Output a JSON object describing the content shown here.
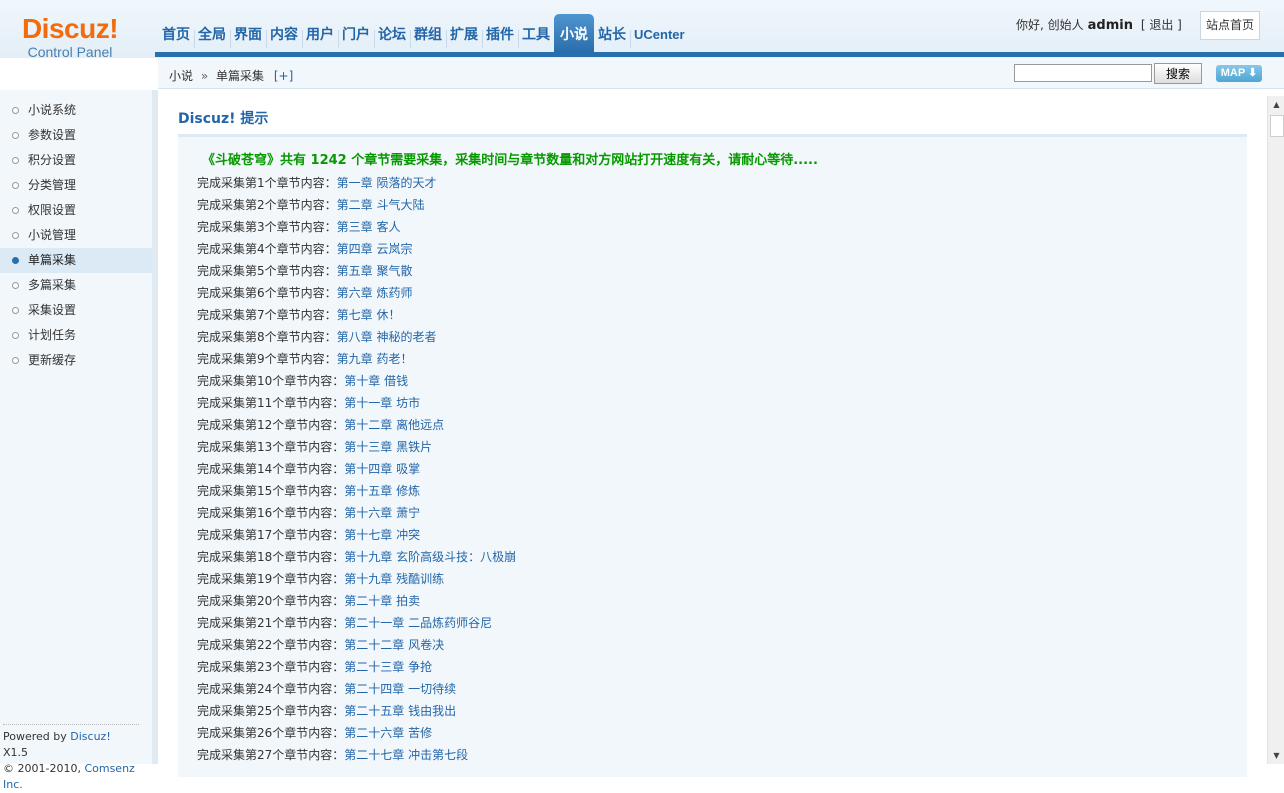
{
  "logo": {
    "brand": "Discuz!",
    "subtitle": "Control Panel"
  },
  "nav": {
    "items": [
      {
        "label": "首页",
        "active": false
      },
      {
        "label": "全局",
        "active": false
      },
      {
        "label": "界面",
        "active": false
      },
      {
        "label": "内容",
        "active": false
      },
      {
        "label": "用户",
        "active": false
      },
      {
        "label": "门户",
        "active": false
      },
      {
        "label": "论坛",
        "active": false
      },
      {
        "label": "群组",
        "active": false
      },
      {
        "label": "扩展",
        "active": false
      },
      {
        "label": "插件",
        "active": false
      },
      {
        "label": "工具",
        "active": false
      },
      {
        "label": "小说",
        "active": true
      },
      {
        "label": "站长",
        "active": false
      },
      {
        "label": "UCenter",
        "active": false
      }
    ]
  },
  "user": {
    "greeting": "你好, 创始人",
    "username": "admin",
    "logout_open": "[",
    "logout_label": "退出",
    "logout_close": "]",
    "site_home_label": "站点首页"
  },
  "breadcrumb": {
    "section": "小说",
    "separator": "»",
    "page": "单篇采集",
    "add_label": "[+]"
  },
  "search": {
    "value": "",
    "button_label": "搜索",
    "map_label": "MAP"
  },
  "sidebar": {
    "items": [
      {
        "label": "小说系统",
        "active": false
      },
      {
        "label": "参数设置",
        "active": false
      },
      {
        "label": "积分设置",
        "active": false
      },
      {
        "label": "分类管理",
        "active": false
      },
      {
        "label": "权限设置",
        "active": false
      },
      {
        "label": "小说管理",
        "active": false
      },
      {
        "label": "单篇采集",
        "active": true
      },
      {
        "label": "多篇采集",
        "active": false
      },
      {
        "label": "采集设置",
        "active": false
      },
      {
        "label": "计划任务",
        "active": false
      },
      {
        "label": "更新缓存",
        "active": false
      }
    ]
  },
  "footer": {
    "powered_prefix": "Powered by",
    "powered_link": "Discuz!",
    "version": "X1.5",
    "copyright_prefix": "© 2001-2010,",
    "company": "Comsenz Inc."
  },
  "main": {
    "title": "Discuz! 提示",
    "notice": "《斗破苍穹》共有 1242 个章节需要采集，采集时间与章节数量和对方网站打开速度有关，请耐心等待.....",
    "chapters": [
      {
        "prefix": "完成采集第1个章节内容：",
        "title": "第一章 陨落的天才"
      },
      {
        "prefix": "完成采集第2个章节内容：",
        "title": "第二章 斗气大陆"
      },
      {
        "prefix": "完成采集第3个章节内容：",
        "title": "第三章 客人"
      },
      {
        "prefix": "完成采集第4个章节内容：",
        "title": "第四章 云岚宗"
      },
      {
        "prefix": "完成采集第5个章节内容：",
        "title": "第五章 聚气散"
      },
      {
        "prefix": "完成采集第6个章节内容：",
        "title": "第六章 炼药师"
      },
      {
        "prefix": "完成采集第7个章节内容：",
        "title": "第七章 休！"
      },
      {
        "prefix": "完成采集第8个章节内容：",
        "title": "第八章 神秘的老者"
      },
      {
        "prefix": "完成采集第9个章节内容：",
        "title": "第九章 药老！"
      },
      {
        "prefix": "完成采集第10个章节内容：",
        "title": "第十章 借钱"
      },
      {
        "prefix": "完成采集第11个章节内容：",
        "title": "第十一章 坊市"
      },
      {
        "prefix": "完成采集第12个章节内容：",
        "title": "第十二章 离他远点"
      },
      {
        "prefix": "完成采集第13个章节内容：",
        "title": "第十三章 黑铁片"
      },
      {
        "prefix": "完成采集第14个章节内容：",
        "title": "第十四章 吸掌"
      },
      {
        "prefix": "完成采集第15个章节内容：",
        "title": "第十五章 修炼"
      },
      {
        "prefix": "完成采集第16个章节内容：",
        "title": "第十六章 萧宁"
      },
      {
        "prefix": "完成采集第17个章节内容：",
        "title": "第十七章 冲突"
      },
      {
        "prefix": "完成采集第18个章节内容：",
        "title": "第十九章 玄阶高级斗技：八极崩"
      },
      {
        "prefix": "完成采集第19个章节内容：",
        "title": "第十九章 残酷训练"
      },
      {
        "prefix": "完成采集第20个章节内容：",
        "title": "第二十章 拍卖"
      },
      {
        "prefix": "完成采集第21个章节内容：",
        "title": "第二十一章 二品炼药师谷尼"
      },
      {
        "prefix": "完成采集第22个章节内容：",
        "title": "第二十二章 风卷决"
      },
      {
        "prefix": "完成采集第23个章节内容：",
        "title": "第二十三章 争抢"
      },
      {
        "prefix": "完成采集第24个章节内容：",
        "title": "第二十四章 一切待续"
      },
      {
        "prefix": "完成采集第25个章节内容：",
        "title": "第二十五章 钱由我出"
      },
      {
        "prefix": "完成采集第26个章节内容：",
        "title": "第二十六章 苦修"
      },
      {
        "prefix": "完成采集第27个章节内容：",
        "title": "第二十七章 冲击第七段"
      }
    ]
  },
  "colors": {
    "link": "#2366A8",
    "notice": "#079900",
    "logo": "#F26C0D",
    "nav_active": "#2a6fad"
  }
}
